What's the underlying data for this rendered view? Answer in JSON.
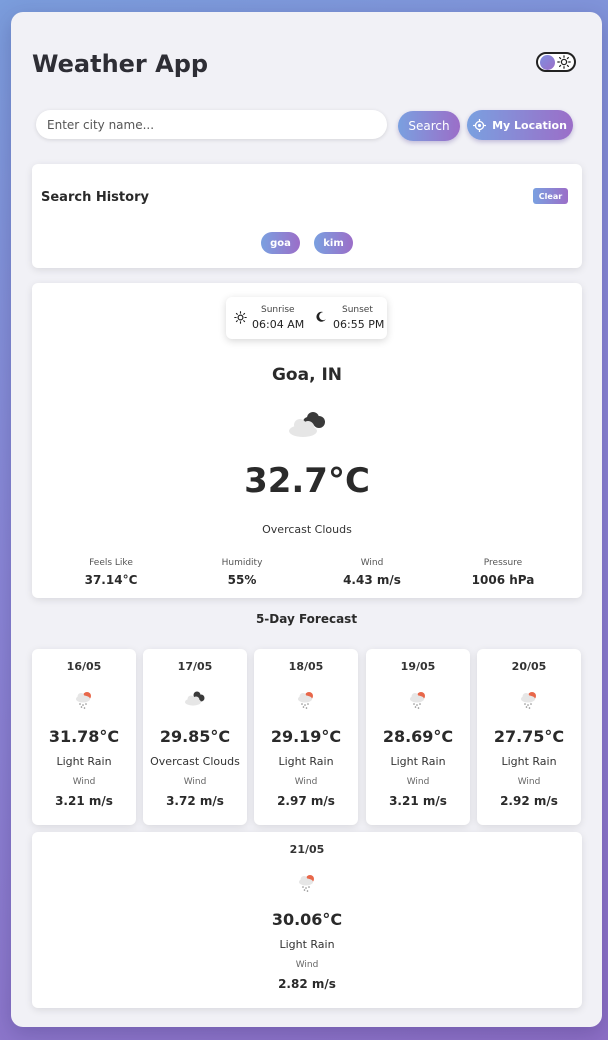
{
  "header": {
    "title": "Weather App"
  },
  "search": {
    "placeholder": "Enter city name...",
    "search_label": "Search",
    "location_label": "My Location"
  },
  "history": {
    "title": "Search History",
    "clear_label": "Clear",
    "items": [
      "goa",
      "kim"
    ]
  },
  "current": {
    "sunrise_label": "Sunrise",
    "sunrise": "06:04 AM",
    "sunset_label": "Sunset",
    "sunset": "06:55 PM",
    "city": "Goa, IN",
    "temperature": "32.7°C",
    "description": "Overcast Clouds",
    "icon": "overcast-clouds-icon",
    "stats": [
      {
        "label": "Feels Like",
        "value": "37.14°C"
      },
      {
        "label": "Humidity",
        "value": "55%"
      },
      {
        "label": "Wind",
        "value": "4.43 m/s"
      },
      {
        "label": "Pressure",
        "value": "1006 hPa"
      }
    ]
  },
  "forecast": {
    "title": "5-Day Forecast",
    "days": [
      {
        "date": "16/05",
        "temp": "31.78°C",
        "desc": "Light Rain",
        "wind_label": "Wind",
        "wind": "3.21 m/s",
        "icon": "light-rain-icon"
      },
      {
        "date": "17/05",
        "temp": "29.85°C",
        "desc": "Overcast Clouds",
        "wind_label": "Wind",
        "wind": "3.72 m/s",
        "icon": "overcast-clouds-icon"
      },
      {
        "date": "18/05",
        "temp": "29.19°C",
        "desc": "Light Rain",
        "wind_label": "Wind",
        "wind": "2.97 m/s",
        "icon": "light-rain-icon"
      },
      {
        "date": "19/05",
        "temp": "28.69°C",
        "desc": "Light Rain",
        "wind_label": "Wind",
        "wind": "3.21 m/s",
        "icon": "light-rain-icon"
      },
      {
        "date": "20/05",
        "temp": "27.75°C",
        "desc": "Light Rain",
        "wind_label": "Wind",
        "wind": "2.92 m/s",
        "icon": "light-rain-icon"
      },
      {
        "date": "21/05",
        "temp": "30.06°C",
        "desc": "Light Rain",
        "wind_label": "Wind",
        "wind": "2.82 m/s",
        "icon": "light-rain-icon"
      }
    ]
  },
  "colors": {
    "accent_start": "#7aa0e0",
    "accent_end": "#9b6ec8",
    "sun": "#e8674a"
  }
}
